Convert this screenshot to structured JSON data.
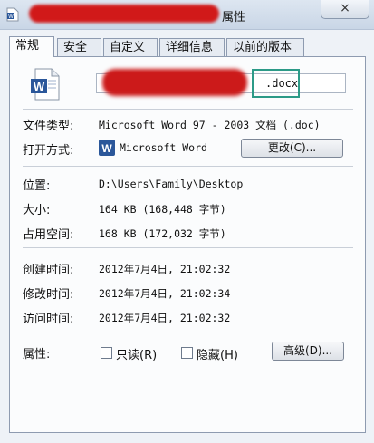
{
  "window": {
    "title_suffix": "属性",
    "close_glyph": "×"
  },
  "tabs": [
    {
      "label": "常规"
    },
    {
      "label": "安全"
    },
    {
      "label": "自定义"
    },
    {
      "label": "详细信息"
    },
    {
      "label": "以前的版本"
    }
  ],
  "file": {
    "name_extension": ".docx"
  },
  "type_row": {
    "label": "文件类型:",
    "value": "Microsoft Word 97 - 2003 文档 (.doc)"
  },
  "open_row": {
    "label": "打开方式:",
    "app": "Microsoft Word",
    "change_button": "更改(C)..."
  },
  "location_row": {
    "label": "位置:",
    "value": "D:\\Users\\Family\\Desktop"
  },
  "size_row": {
    "label": "大小:",
    "value": "164 KB (168,448 字节)"
  },
  "disk_row": {
    "label": "占用空间:",
    "value": "168 KB (172,032 字节)"
  },
  "created_row": {
    "label": "创建时间:",
    "value": "2012年7月4日, 21:02:32"
  },
  "modified_row": {
    "label": "修改时间:",
    "value": "2012年7月4日, 21:02:34"
  },
  "accessed_row": {
    "label": "访问时间:",
    "value": "2012年7月4日, 21:02:32"
  },
  "attributes": {
    "label": "属性:",
    "readonly": "只读(R)",
    "hidden": "隐藏(H)",
    "advanced_button": "高级(D)..."
  },
  "icons": {
    "title": "word-document-icon",
    "file": "word-document-icon",
    "app": "word-app-icon"
  },
  "colors": {
    "redaction": "#d11919",
    "highlight": "#2c9a87",
    "word_blue": "#2b579a"
  }
}
